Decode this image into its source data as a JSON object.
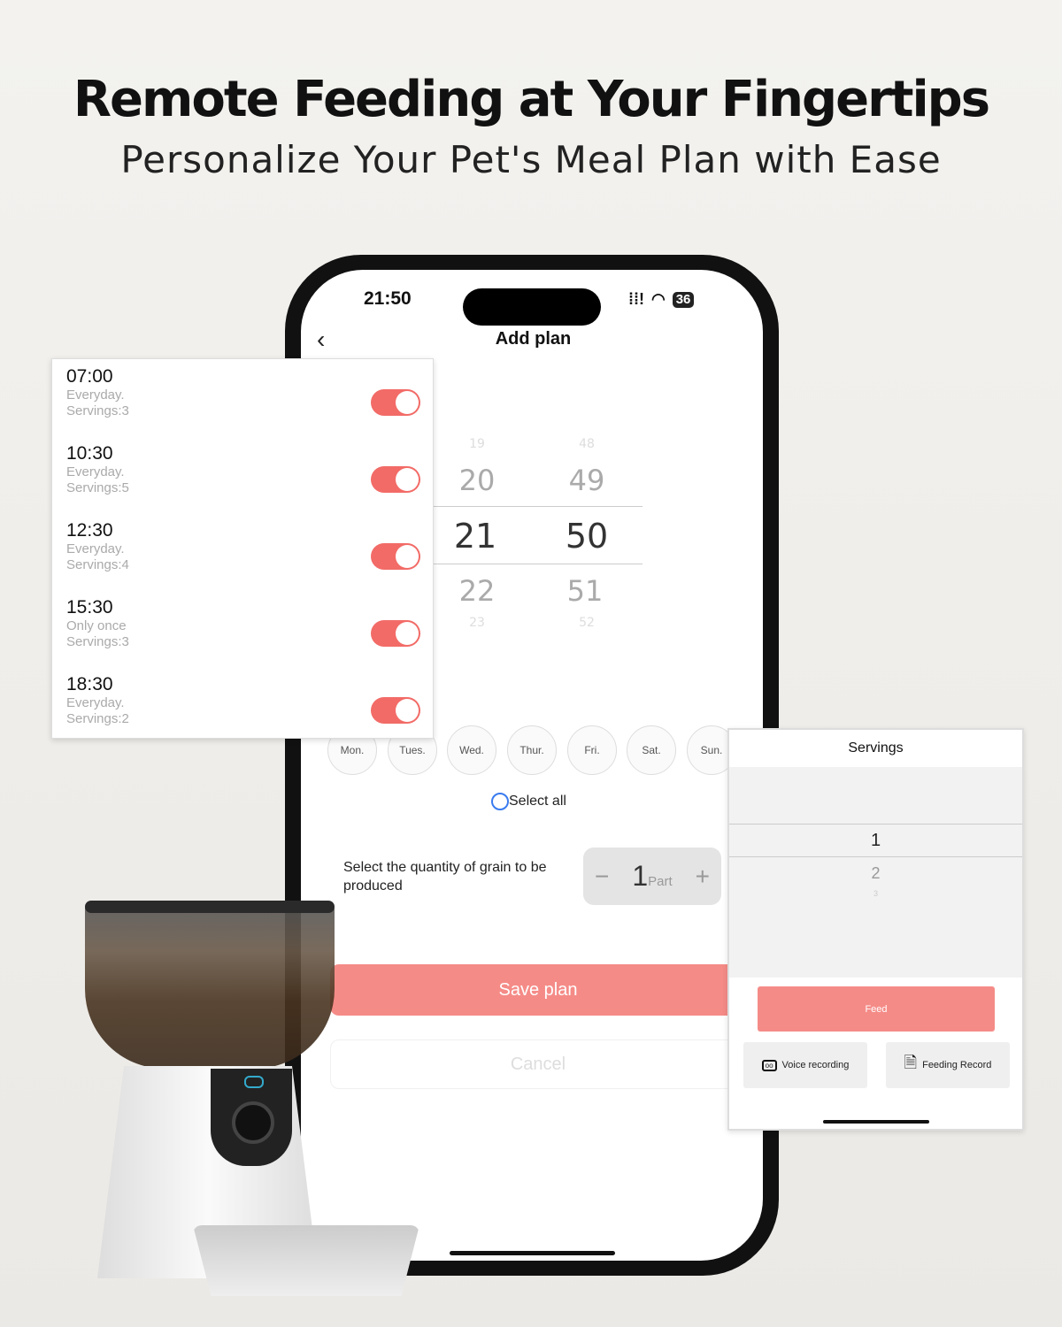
{
  "headline": {
    "title": "Remote Feeding at Your Fingertips",
    "subtitle": "Personalize Your Pet's Meal Plan with Ease"
  },
  "status_bar": {
    "time": "21:50",
    "signal_icon": "signal-icon",
    "wifi_icon": "wifi-icon",
    "battery": "36"
  },
  "nav": {
    "back_icon": "chevron-left-icon",
    "title": "Add plan"
  },
  "time_picker": {
    "hours": [
      "19",
      "20",
      "21",
      "22",
      "23"
    ],
    "minutes": [
      "48",
      "49",
      "50",
      "51",
      "52"
    ],
    "selected_hour": "21",
    "selected_minute": "50"
  },
  "days": [
    "Mon.",
    "Tues.",
    "Wed.",
    "Thur.",
    "Fri.",
    "Sat.",
    "Sun."
  ],
  "select_all": "Select all",
  "quantity": {
    "label": "Select the quantity of grain to be produced",
    "value": "1",
    "unit": "Part",
    "minus": "−",
    "plus": "+"
  },
  "actions": {
    "save": "Save plan",
    "cancel": "Cancel"
  },
  "schedule": [
    {
      "time": "07:00",
      "repeat": "Everyday.",
      "servings": "Servings:3",
      "enabled": true
    },
    {
      "time": "10:30",
      "repeat": "Everyday.",
      "servings": "Servings:5",
      "enabled": true
    },
    {
      "time": "12:30",
      "repeat": "Everyday.",
      "servings": "Servings:4",
      "enabled": true
    },
    {
      "time": "15:30",
      "repeat": "Only once",
      "servings": "Servings:3",
      "enabled": true
    },
    {
      "time": "18:30",
      "repeat": "Everyday.",
      "servings": "Servings:2",
      "enabled": true
    }
  ],
  "servings_panel": {
    "title": "Servings",
    "options": [
      "1",
      "2",
      "3"
    ],
    "selected": "1",
    "feed": "Feed",
    "voice": "Voice recording",
    "record": "Feeding Record"
  },
  "colors": {
    "accent": "#f58b87",
    "toggle": "#f26b67",
    "radio": "#3a7bef"
  }
}
